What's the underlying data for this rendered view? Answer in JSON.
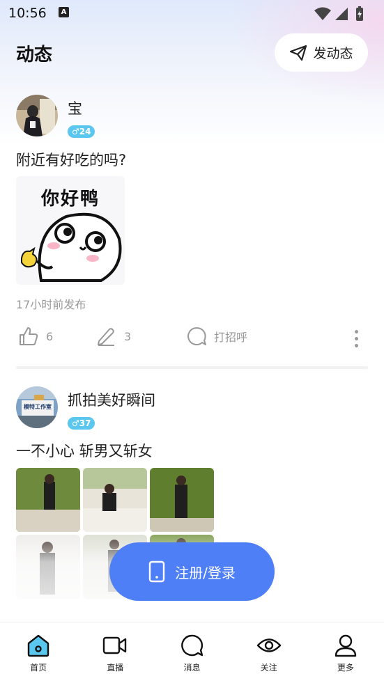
{
  "status_bar": {
    "time": "10:56",
    "notification_icon": "A"
  },
  "header": {
    "title": "动态",
    "post_button_label": "发动态"
  },
  "posts": [
    {
      "username": "宝",
      "badge": "♂24",
      "text": "附近有好吃的吗?",
      "sticker_text": "你好鸭",
      "time": "17小时前发布",
      "likes": "6",
      "comments": "3",
      "greet_label": "打招呼"
    },
    {
      "username": "抓拍美好瞬间",
      "badge": "♂37",
      "text": "一不小心 斩男又斩女",
      "avatar_sign_text": "模特工作室"
    }
  ],
  "login_button_label": "注册/登录",
  "tabs": [
    {
      "label": "首页",
      "icon": "home-icon",
      "active": true
    },
    {
      "label": "直播",
      "icon": "video-camera-icon",
      "active": false
    },
    {
      "label": "消息",
      "icon": "chat-bubble-icon",
      "active": false
    },
    {
      "label": "关注",
      "icon": "eye-icon",
      "active": false
    },
    {
      "label": "更多",
      "icon": "person-icon",
      "active": false
    }
  ],
  "colors": {
    "accent": "#4f7ff6",
    "badge": "#5cc7ee",
    "active_tab": "#5cc7ee",
    "muted_text": "#999999"
  }
}
